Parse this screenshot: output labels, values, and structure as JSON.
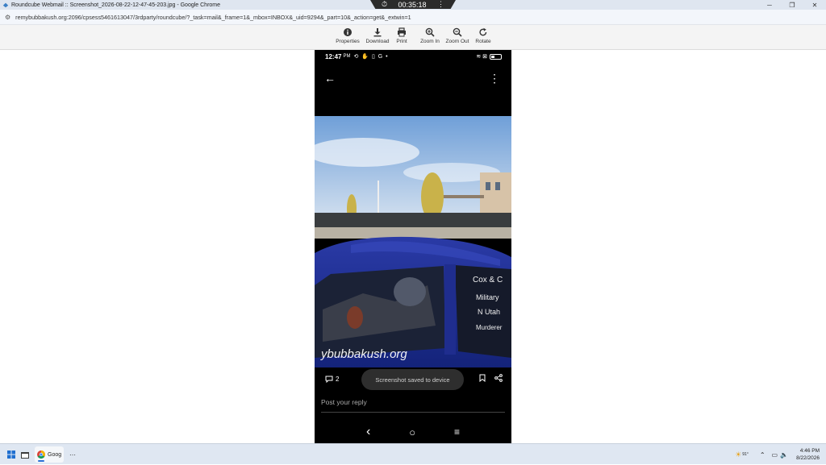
{
  "window": {
    "title": "Roundcube Webmail :: Screenshot_2026-08-22-12-47-45-203.jpg - Google Chrome",
    "minimize": "─",
    "restore": "❐",
    "close": "✕"
  },
  "recorder": {
    "timer": "00:35:18",
    "menu": "⋮"
  },
  "address": {
    "url": "remybubbakush.org:2096/cpsess5461613047/3rdparty/roundcube/?_task=mail&_frame=1&_mbox=INBOX&_uid=9294&_part=10&_action=get&_extwin=1"
  },
  "toolbar": {
    "properties": "Properties",
    "download": "Download",
    "print": "Print",
    "zoom_in": "Zoom In",
    "zoom_out": "Zoom Out",
    "rotate": "Rotate"
  },
  "phone": {
    "time": "12:47",
    "ampm": "PM",
    "status_icons": "⟲ ✋ ▯ G •",
    "signal": "≋ ⊠",
    "battery_level": 0.4,
    "comment_count": "2",
    "toast": "Screenshot saved to device",
    "reply_placeholder": "Post your reply",
    "nav_back": "‹",
    "nav_home": "○",
    "nav_recents": "≡",
    "car_text_door": "ybubbakush.org",
    "car_text_window_1": "Cox & C",
    "car_text_window_2": "Military",
    "car_text_window_3": "N Utah",
    "car_text_window_4": "Murderer"
  },
  "taskbar": {
    "app_label": "Goog",
    "more": "⋯",
    "temperature": "91°",
    "time": "4:46 PM",
    "date": "8/22/2026"
  }
}
